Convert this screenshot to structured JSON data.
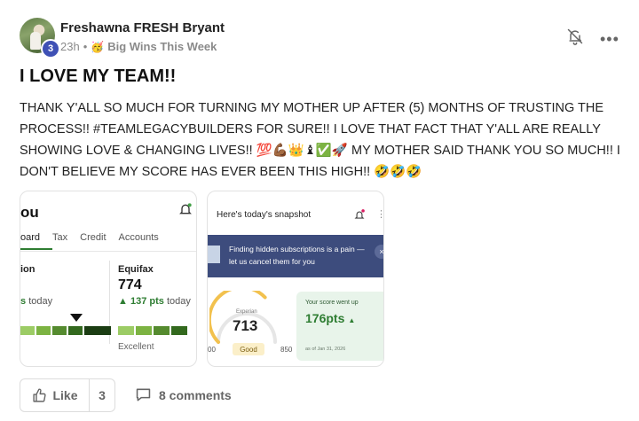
{
  "post": {
    "author": "Freshawna FRESH Bryant",
    "level": "3",
    "time": "23h",
    "separator": "•",
    "category_emoji": "🥳",
    "category": "Big Wins This Week",
    "title": "I LOVE MY TEAM!!",
    "body": "THANK Y'ALL SO MUCH FOR TURNING MY MOTHER UP AFTER (5) MONTHS OF TRUSTING THE PROCESS!! #TEAMLEGACYBUILDERS FOR SURE!! I LOVE THAT FACT THAT Y'ALL ARE REALLY SHOWING LOVE & CHANGING LIVES!! 💯💪🏾👑♝✅🚀 MY MOTHER SAID THANK YOU SO MUCH!! I DON'T BELIEVE MY SCORE HAS EVER BEEN THIS HIGH!! 🤣🤣🤣",
    "more_icon": "•••"
  },
  "image1": {
    "title": "ou",
    "tabs": [
      "oard",
      "Tax",
      "Credit",
      "Accounts"
    ],
    "left_bureau": "ion",
    "left_today_prefix": "s",
    "left_today": "today",
    "bureau": "Equifax",
    "score": "774",
    "change_arrow": "▲",
    "change": "137 pts",
    "today": "today",
    "rating": "Excellent",
    "bar_colors": [
      "#9ccc65",
      "#7cb342",
      "#558b2f",
      "#33691e",
      "#1b3d13"
    ]
  },
  "image2": {
    "title": "Here's today's snapshot",
    "kebab": "⋮",
    "banner_text": "Finding hidden subscriptions is a pain —let us cancel them for you",
    "banner_close": "×",
    "gauge_bureau": "Experian",
    "gauge_score": "713",
    "gauge_rating": "Good",
    "gauge_min": "00",
    "gauge_max": "850",
    "panel_label": "Your score went up",
    "panel_pts": "176pts",
    "panel_arrow": "▲",
    "panel_date": "as of Jan 31, 2026",
    "gauge_fraction": 0.6
  },
  "footer": {
    "like_label": "Like",
    "like_count": "3",
    "comments_label": "8 comments"
  },
  "colors": {
    "accent_green": "#2e7d32",
    "banner_blue": "#3d4c7d",
    "badge_blue": "#3f51b5"
  }
}
